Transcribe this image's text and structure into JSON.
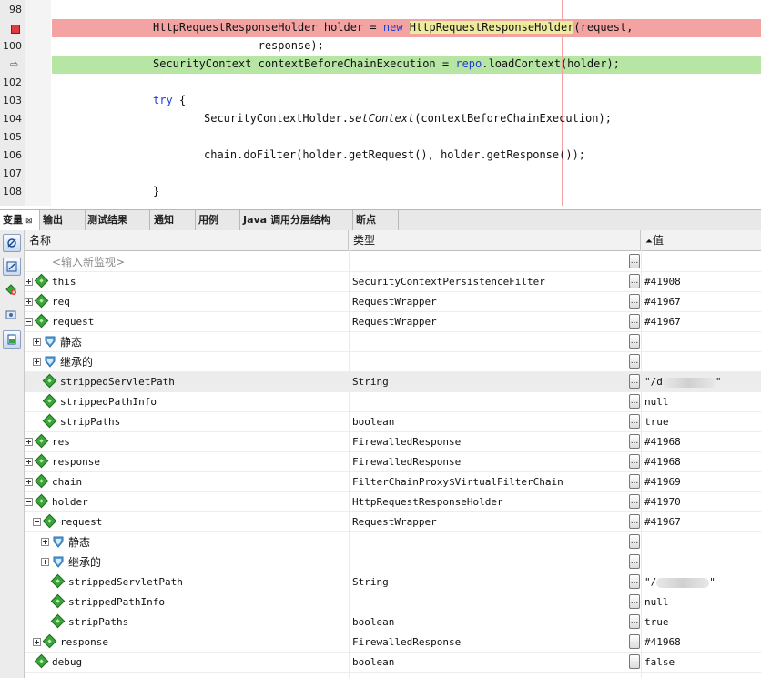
{
  "editor": {
    "lines": [
      {
        "num": "98",
        "text": ""
      },
      {
        "num": "",
        "marker": "breakpoint",
        "text_parts": [
          "HttpRequestResponseHolder holder = ",
          "new",
          " ",
          "HttpRequestResponseHolder",
          "(request,"
        ]
      },
      {
        "num": "100",
        "text": "                response);"
      },
      {
        "num": "",
        "marker": "current-line-arrow",
        "text_parts": [
          "SecurityContext contextBeforeChainExecution = ",
          "repo",
          ".loadContext(holder);"
        ]
      },
      {
        "num": "102",
        "text": ""
      },
      {
        "num": "103",
        "text_parts": [
          "try",
          " {"
        ]
      },
      {
        "num": "104",
        "text_parts": [
          "SecurityContextHolder.",
          "setContext",
          "(contextBeforeChainExecution);"
        ]
      },
      {
        "num": "105",
        "text": ""
      },
      {
        "num": "106",
        "text": "chain.doFilter(holder.getRequest(), holder.getResponse());"
      },
      {
        "num": "107",
        "text": ""
      },
      {
        "num": "108",
        "text": "}"
      }
    ]
  },
  "tabs": [
    {
      "label": "变量",
      "close": "⊠",
      "active": true
    },
    {
      "label": "输出"
    },
    {
      "label": "测试结果"
    },
    {
      "label": "通知"
    },
    {
      "label": "用例"
    },
    {
      "label": "Java 调用分层结构"
    },
    {
      "label": "断点"
    }
  ],
  "toolbar_icons": [
    "watch-icon",
    "watch-step-icon",
    "add-watch-icon",
    "camera-icon",
    "show-static-icon"
  ],
  "table": {
    "columns": {
      "name": "名称",
      "type": "类型",
      "value": "值",
      "sort_indicator": "⏶"
    },
    "ellipsis": "...",
    "rows": [
      {
        "name": "<输入新监视>",
        "type": "",
        "value": "",
        "placeholder": true,
        "indent": 0
      },
      {
        "name": "this",
        "type": "SecurityContextPersistenceFilter",
        "value": "#41908",
        "expander": "plus",
        "icon": "diamond",
        "indent": 0
      },
      {
        "name": "req",
        "type": "RequestWrapper",
        "value": "#41967",
        "expander": "plus",
        "icon": "diamond",
        "indent": 0
      },
      {
        "name": "request",
        "type": "RequestWrapper",
        "value": "#41967",
        "expander": "minus",
        "icon": "diamond",
        "indent": 0
      },
      {
        "name": "静态",
        "type": "",
        "value": "",
        "expander": "plus",
        "icon": "shield",
        "indent": 1,
        "cjk": true
      },
      {
        "name": "继承的",
        "type": "",
        "value": "",
        "expander": "plus",
        "icon": "shield",
        "indent": 1,
        "cjk": true
      },
      {
        "name": "strippedServletPath",
        "type": "String",
        "value": "\"/d",
        "value_end": "\"",
        "blurred": true,
        "icon": "diamond",
        "indent": 1,
        "selected": true
      },
      {
        "name": "strippedPathInfo",
        "type": "",
        "value": "null",
        "icon": "diamond",
        "indent": 1
      },
      {
        "name": "stripPaths",
        "type": "boolean",
        "value": "true",
        "icon": "diamond",
        "indent": 1
      },
      {
        "name": "res",
        "type": "FirewalledResponse",
        "value": "#41968",
        "expander": "plus",
        "icon": "diamond",
        "indent": 0
      },
      {
        "name": "response",
        "type": "FirewalledResponse",
        "value": "#41968",
        "expander": "plus",
        "icon": "diamond",
        "indent": 0
      },
      {
        "name": "chain",
        "type": "FilterChainProxy$VirtualFilterChain",
        "value": "#41969",
        "expander": "plus",
        "icon": "diamond",
        "indent": 0
      },
      {
        "name": "holder",
        "type": "HttpRequestResponseHolder",
        "value": "#41970",
        "expander": "minus",
        "icon": "diamond",
        "indent": 0
      },
      {
        "name": "request",
        "type": "RequestWrapper",
        "value": "#41967",
        "expander": "minus",
        "icon": "diamond",
        "indent": 1
      },
      {
        "name": "静态",
        "type": "",
        "value": "",
        "expander": "plus",
        "icon": "shield",
        "indent": 2,
        "cjk": true
      },
      {
        "name": "继承的",
        "type": "",
        "value": "",
        "expander": "plus",
        "icon": "shield",
        "indent": 2,
        "cjk": true
      },
      {
        "name": "strippedServletPath",
        "type": "String",
        "value": "\"/",
        "value_end": "\"",
        "blurred": true,
        "icon": "diamond",
        "indent": 2
      },
      {
        "name": "strippedPathInfo",
        "type": "",
        "value": "null",
        "icon": "diamond",
        "indent": 2
      },
      {
        "name": "stripPaths",
        "type": "boolean",
        "value": "true",
        "icon": "diamond",
        "indent": 2
      },
      {
        "name": "response",
        "type": "FirewalledResponse",
        "value": "#41968",
        "expander": "plus",
        "icon": "diamond",
        "indent": 1
      },
      {
        "name": "debug",
        "type": "boolean",
        "value": "false",
        "icon": "diamond",
        "indent": 0,
        "no_expander_slot": true
      }
    ]
  },
  "colors": {
    "breakpoint_line": "#f4a3a3",
    "current_line": "#b7e6a4",
    "keyword": "#1e3ed0",
    "variable_icon": "#3da33d",
    "shield_icon": "#5aa0d8"
  }
}
